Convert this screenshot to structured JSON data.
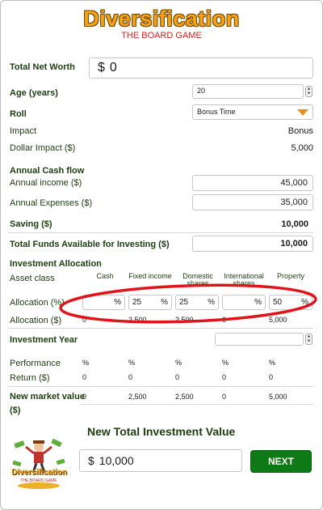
{
  "header": {
    "title": "Diversification",
    "subtitle": "THE BOARD GAME"
  },
  "net_worth": {
    "label": "Total Net Worth",
    "currency": "$",
    "value": "0"
  },
  "age": {
    "label": "Age (years)",
    "value": "20"
  },
  "roll": {
    "label": "Roll",
    "value": "Bonus Time"
  },
  "impact": {
    "label": "Impact",
    "value": "Bonus"
  },
  "dollar_impact": {
    "label": "Dollar Impact ($)",
    "value": "5,000"
  },
  "cashflow": {
    "heading": "Annual Cash flow",
    "income_label": "Annual income ($)",
    "income_value": "45,000",
    "expenses_label": "Annual Expenses ($)",
    "expenses_value": "35,000",
    "saving_label": "Saving ($)",
    "saving_value": "10,000",
    "funds_label": "Total Funds Available for Investing ($)",
    "funds_value": "10,000"
  },
  "allocation": {
    "heading": "Investment Allocation",
    "asset_class_label": "Asset class",
    "columns": [
      "Cash",
      "Fixed income",
      "Domestic shares",
      "International shares",
      "Property"
    ],
    "pct_label": "Allocation (%)",
    "pct_values": [
      "",
      "25",
      "25",
      "",
      "50"
    ],
    "pct_unit": "%",
    "dollar_label": "Allocation ($)",
    "dollar_values": [
      "0",
      "2,500",
      "2,500",
      "0",
      "5,000"
    ]
  },
  "investment_year": {
    "label": "Investment Year",
    "value": ""
  },
  "performance": {
    "label": "Performance",
    "values": [
      "%",
      "%",
      "%",
      "%",
      "%"
    ]
  },
  "return": {
    "label": "Return ($)",
    "values": [
      "0",
      "0",
      "0",
      "0",
      "0"
    ]
  },
  "new_market": {
    "label": "New market value",
    "unit": "($)",
    "values": [
      "0",
      "2,500",
      "2,500",
      "0",
      "5,000"
    ]
  },
  "total": {
    "heading": "New Total Investment Value",
    "currency": "$",
    "value": "10,000"
  },
  "logo": {
    "title": "Diversification",
    "subtitle": "THE BOARD GAME"
  },
  "next_button": "NEXT",
  "colors": {
    "brand_orange": "#f2a31a",
    "accent_red": "#d3231e",
    "next_green": "#0d7a15",
    "label_green": "#1c3d10",
    "highlight_circle": "#e0141b"
  }
}
